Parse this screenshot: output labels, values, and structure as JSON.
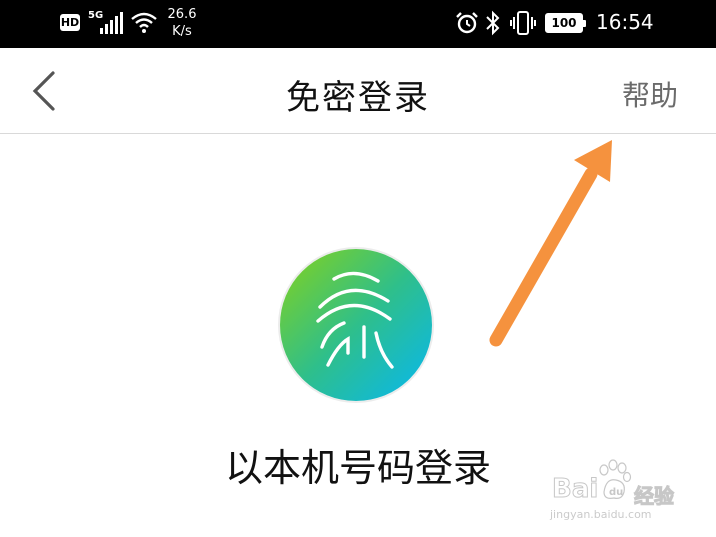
{
  "status_bar": {
    "hd": "HD",
    "network": "5G",
    "speed_value": "26.6",
    "speed_unit": "K/s",
    "battery": "100",
    "time": "16:54"
  },
  "nav": {
    "title": "免密登录",
    "help_label": "帮助"
  },
  "main": {
    "login_label": "以本机号码登录"
  },
  "watermark": {
    "brand": "Bai",
    "name": "经验",
    "url": "jingyan.baidu.com"
  },
  "colors": {
    "arrow": "#f5923e",
    "logo_gradient_start": "#86d21a",
    "logo_gradient_end": "#06b7f2",
    "help_text": "#6b6b6b"
  }
}
